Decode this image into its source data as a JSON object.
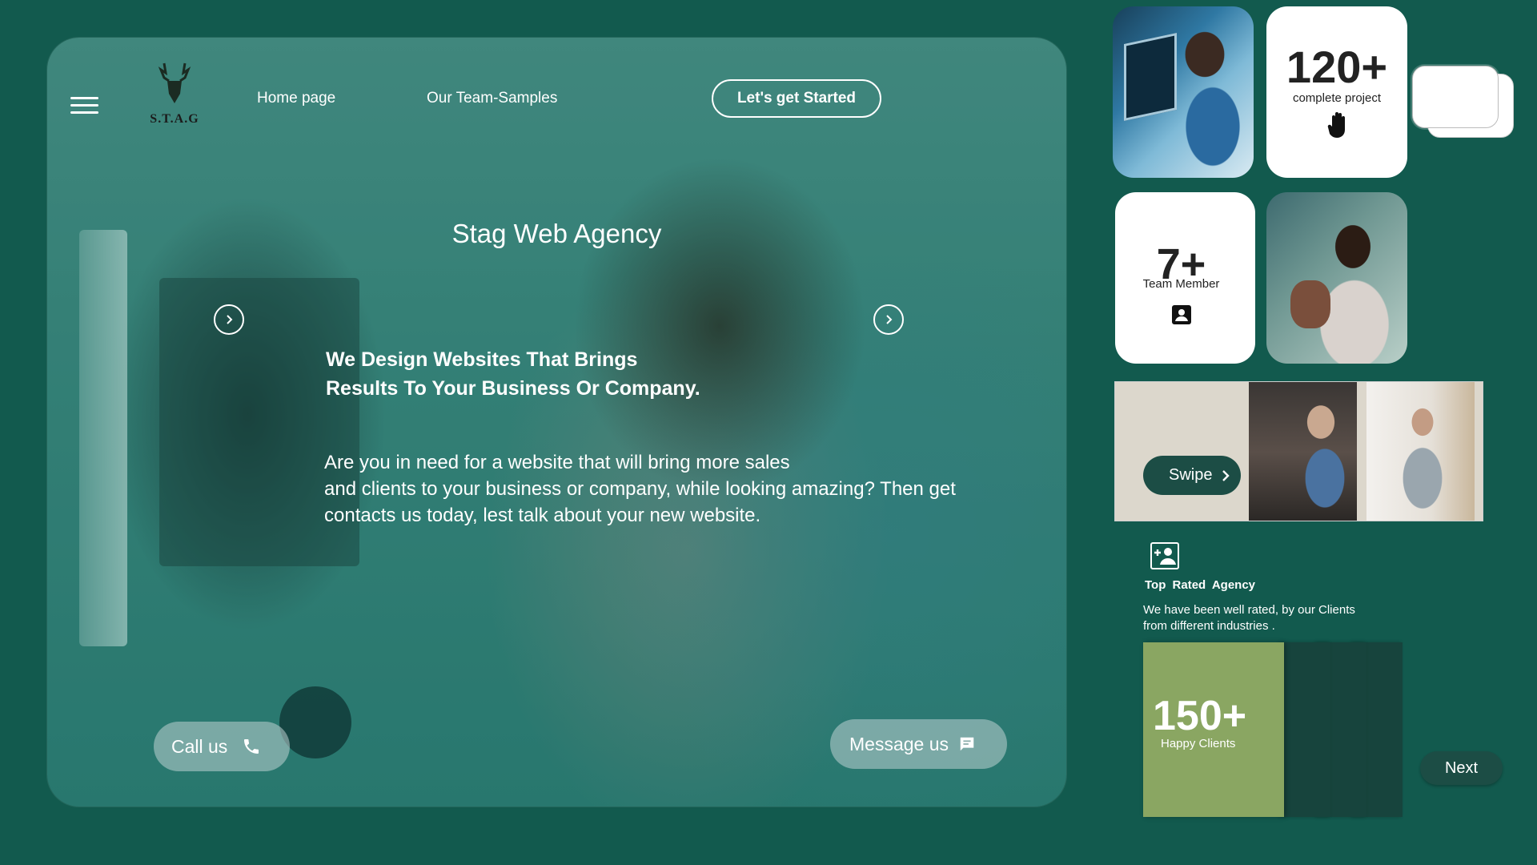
{
  "brand": {
    "logo_text": "S.T.A.G"
  },
  "nav": {
    "home": "Home page",
    "team": "Our Team-Samples",
    "cta": "Let's get Started"
  },
  "hero": {
    "title": "Stag Web Agency",
    "headline_line1": "We Design Websites That Brings",
    "headline_line2": "Results To Your Business Or Company.",
    "desc_line1": "Are you in need for a website that will bring more sales",
    "desc_line2": "and clients to your business or company, while looking amazing? Then get",
    "desc_line3": "contacts us today, lest talk about your new website."
  },
  "actions": {
    "call": "Call us",
    "message": "Message us"
  },
  "stats": {
    "projects": {
      "value": "120+",
      "label": "complete project",
      "icon": "hand-icon"
    },
    "team": {
      "value": "7+",
      "label": "Team Member",
      "icon": "contact-badge-icon"
    },
    "clients": {
      "value": "150+",
      "label": "Happy Clients"
    }
  },
  "gallery": {
    "swipe": "Swipe"
  },
  "rated": {
    "title": "Top Rated  Agency",
    "desc_line1": "We have been well rated, by our Clients",
    "desc_line2": "from different industries .",
    "icon": "add-person-icon"
  },
  "next": "Next",
  "colors": {
    "background": "#125a4e",
    "dark_green": "#1c4d45",
    "olive": "#8aa662"
  }
}
